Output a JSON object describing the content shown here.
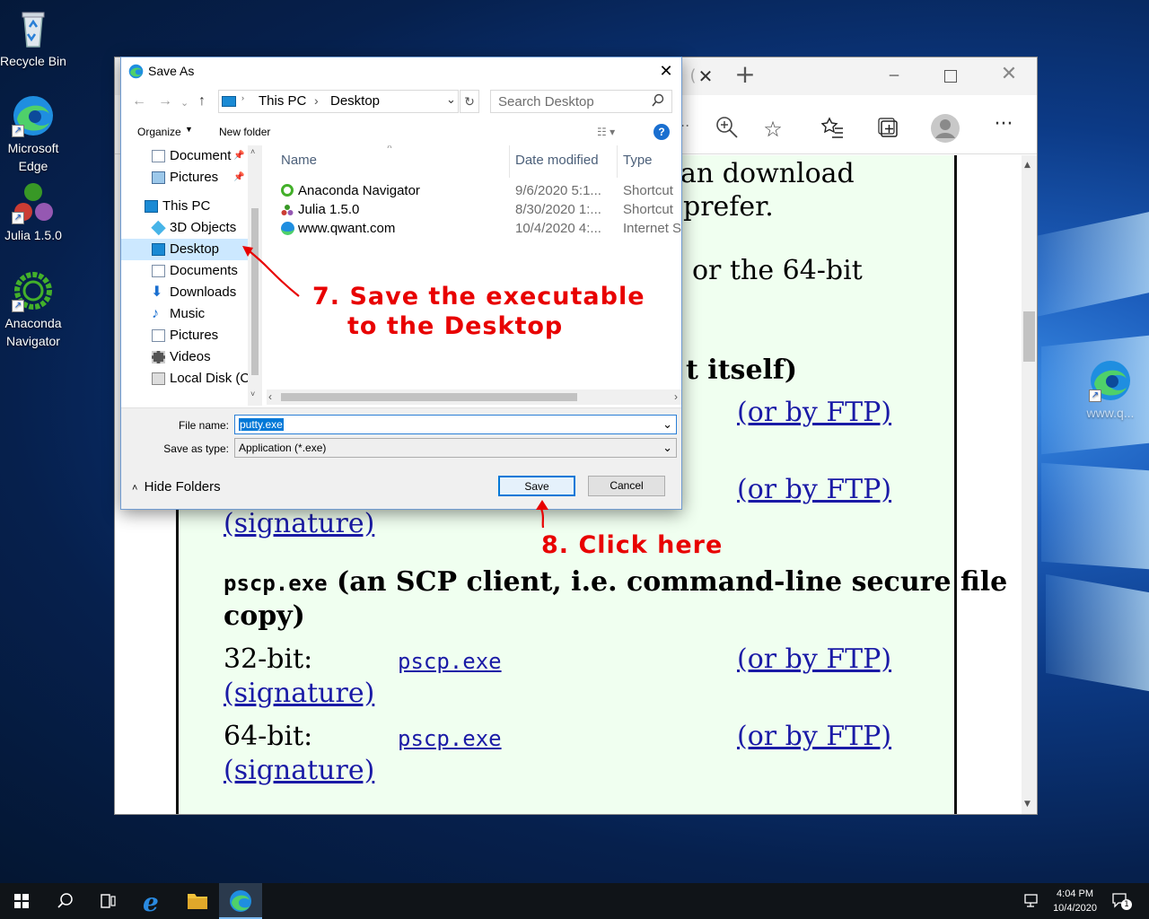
{
  "desktop": {
    "icons": [
      {
        "label": "Recycle Bin"
      },
      {
        "label": "Microsoft Edge"
      },
      {
        "label": "Julia 1.5.0"
      },
      {
        "label": "Anaconda Navigator"
      }
    ],
    "right_icon_label": "www.q..."
  },
  "browser": {
    "tab_close": "✕",
    "new_tab": "+",
    "address_fragment": "..",
    "page": {
      "line1": "an download",
      "line2": "prefer.",
      "line3": "or the 64-bit",
      "line4": "t itself)",
      "ftp1": "(or by FTP)",
      "ftp2": "(or by FTP)",
      "sig1": "(signature)",
      "pscp_heading_code": "pscp.exe",
      "pscp_heading_text": "(an SCP client, i.e. command-line secure file",
      "pscp_heading_text2": "copy)",
      "row32_label": "32-bit:",
      "row32_link": "pscp.exe",
      "row32_ftp": "(or by FTP)",
      "row32_sig": "(signature)",
      "row64_label": "64-bit:",
      "row64_link": "pscp.exe",
      "row64_ftp": "(or by FTP)",
      "row64_sig": "(signature)"
    }
  },
  "dialog": {
    "title": "Save As",
    "breadcrumb": [
      "This PC",
      "Desktop"
    ],
    "search_placeholder": "Search Desktop",
    "organize": "Organize",
    "new_folder": "New folder",
    "nav_items": [
      {
        "label": "Document",
        "pinned": true
      },
      {
        "label": "Pictures",
        "pinned": true
      },
      {
        "label": "This PC"
      },
      {
        "label": "3D Objects"
      },
      {
        "label": "Desktop",
        "selected": true
      },
      {
        "label": "Documents"
      },
      {
        "label": "Downloads"
      },
      {
        "label": "Music"
      },
      {
        "label": "Pictures"
      },
      {
        "label": "Videos"
      },
      {
        "label": "Local Disk (C"
      }
    ],
    "columns": {
      "name": "Name",
      "date": "Date modified",
      "type": "Type"
    },
    "files": [
      {
        "name": "Anaconda Navigator",
        "date": "9/6/2020 5:1...",
        "type": "Shortcut"
      },
      {
        "name": "Julia 1.5.0",
        "date": "8/30/2020 1:...",
        "type": "Shortcut"
      },
      {
        "name": "www.qwant.com",
        "date": "10/4/2020 4:...",
        "type": "Internet S"
      }
    ],
    "file_name_label": "File name:",
    "file_name_value": "putty.exe",
    "save_type_label": "Save as type:",
    "save_type_value": "Application (*.exe)",
    "hide_folders": "Hide Folders",
    "save_button": "Save",
    "cancel_button": "Cancel"
  },
  "annotations": {
    "step7_line1": "7. Save the executable",
    "step7_line2": "to the Desktop",
    "step8": "8. Click here",
    "color": "#e80000"
  },
  "taskbar": {
    "time": "4:04 PM",
    "date": "10/4/2020",
    "notification_count": "1"
  }
}
